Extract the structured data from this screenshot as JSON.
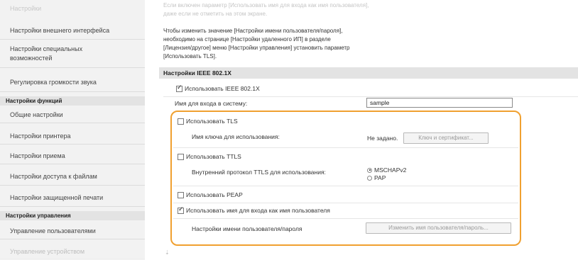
{
  "sidebar": {
    "top_faded": "Настройки",
    "items": [
      "Настройки внешнего интерфейса",
      "Настройки специальных возможностей",
      "Регулировка громкости звука"
    ],
    "section_functions": "Настройки функций",
    "function_items": [
      "Общие настройки",
      "Настройки принтера",
      "Настройки приема",
      "Настройки доступа к файлам",
      "Настройки защищенной печати"
    ],
    "section_management": "Настройки управления",
    "management_items": [
      "Управление пользователями",
      "Управление устройством"
    ]
  },
  "message": {
    "faded_1": "Если включен параметр [Использовать имя для входа как имя пользователя],",
    "faded_2": "даже если не отметить на этом экране.",
    "line_1": "Чтобы изменить значение [Настройки имени пользователя/пароля],",
    "line_2": "необходимо на странице [Настройки удаленного ИП] в разделе",
    "line_3": "[Лицензия/другое] меню [Настройки управления] установить параметр",
    "line_4": "[Использовать TLS]."
  },
  "section": {
    "title": "Настройки IEEE 802.1X"
  },
  "form": {
    "use_ieee_label": "Использовать IEEE 802.1X",
    "use_ieee_checked": true,
    "login_name_label": "Имя для входа в систему:",
    "login_name_value": "sample",
    "use_tls_label": "Использовать TLS",
    "use_tls_checked": false,
    "key_label": "Имя ключа для использования:",
    "key_value": "Не задано.",
    "key_button": "Ключ и сертификат...",
    "use_ttls_label": "Использовать TTLS",
    "use_ttls_checked": false,
    "ttls_protocol_label": "Внутренний протокол TTLS для использования:",
    "ttls_option_1": "MSCHAPv2",
    "ttls_option_2": "PAP",
    "ttls_selected": "MSCHAPv2",
    "use_peap_label": "Использовать PEAP",
    "use_peap_checked": false,
    "use_login_as_user_label": "Использовать имя для входа как имя пользователя",
    "use_login_as_user_checked": true,
    "user_settings_label": "Настройки имени пользователя/пароля",
    "change_user_button": "Изменить имя пользователя/пароль..."
  },
  "colors": {
    "highlight": "#f0a030"
  }
}
